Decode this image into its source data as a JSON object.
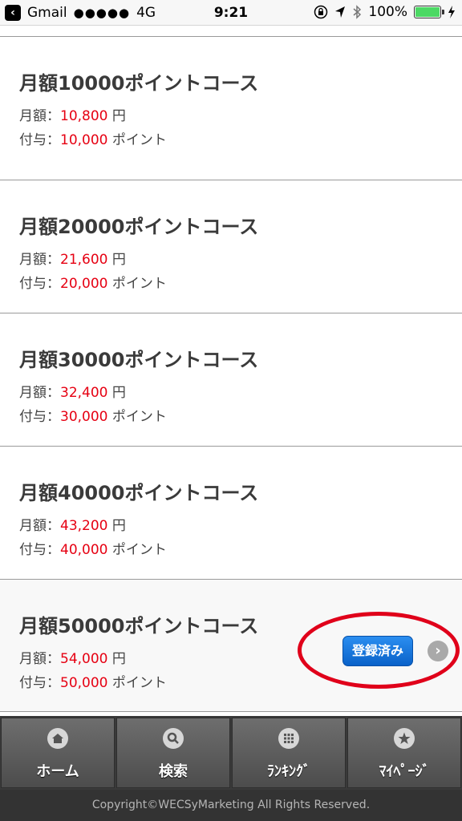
{
  "status_bar": {
    "back_app": "Gmail",
    "signal": "●●●●●",
    "network": "4G",
    "time": "9:21",
    "battery": "100%",
    "battery_level": 1.0
  },
  "labels": {
    "monthly_fee": "月額：",
    "granted": "付与：",
    "yen": "円",
    "points": "ポイント"
  },
  "courses": [
    {
      "title": "月額10000ポイントコース",
      "price": "10,800",
      "points": "10,000"
    },
    {
      "title": "月額20000ポイントコース",
      "price": "21,600",
      "points": "20,000"
    },
    {
      "title": "月額30000ポイントコース",
      "price": "32,400",
      "points": "30,000"
    },
    {
      "title": "月額40000ポイントコース",
      "price": "43,200",
      "points": "40,000"
    },
    {
      "title": "月額50000ポイントコース",
      "price": "54,000",
      "points": "50,000",
      "registered_label": "登録済み"
    }
  ],
  "bottom_nav": [
    {
      "label": "ホーム",
      "icon": "home-icon"
    },
    {
      "label": "検索",
      "icon": "search-icon"
    },
    {
      "label": "ﾗﾝｷﾝｸﾞ",
      "icon": "grid-icon"
    },
    {
      "label": "ﾏｲﾍﾟｰｼﾞ",
      "icon": "star-icon"
    }
  ],
  "footer": "Copyright©WECSyMarketing All Rights Reserved.",
  "colors": {
    "price_red": "#e60012",
    "button_blue": "#0a62c9",
    "annotation_red": "#e0001a"
  }
}
